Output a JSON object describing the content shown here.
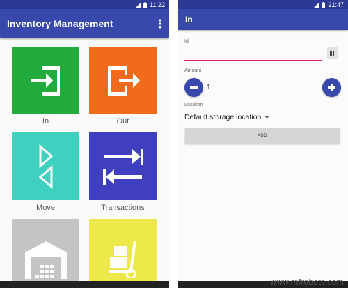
{
  "left_screen": {
    "status_time": "11:22",
    "app_title": "Inventory Management",
    "tiles": [
      {
        "label": "In",
        "color": "#22aa3c",
        "icon": "sign-in-icon"
      },
      {
        "label": "Out",
        "color": "#f26a1b",
        "icon": "sign-out-icon"
      },
      {
        "label": "Move",
        "color": "#3fd0c0",
        "icon": "move-arrows-icon"
      },
      {
        "label": "Transactions",
        "color": "#3f3fbf",
        "icon": "transfer-arrows-icon"
      },
      {
        "label": "",
        "color": "#c4c4c4",
        "icon": "warehouse-icon"
      },
      {
        "label": "",
        "color": "#ede84a",
        "icon": "hand-truck-icon"
      }
    ]
  },
  "right_screen": {
    "status_time": "21:47",
    "screen_title": "In",
    "id_label": "Id",
    "id_value": "",
    "amount_label": "Amount",
    "amount_value": "1",
    "location_label": "Location",
    "location_value": "Default storage location",
    "add_label": "ADD",
    "accent_color": "#e91e63",
    "primary_color": "#3949ab"
  },
  "watermark": "www.mfrobots.com"
}
